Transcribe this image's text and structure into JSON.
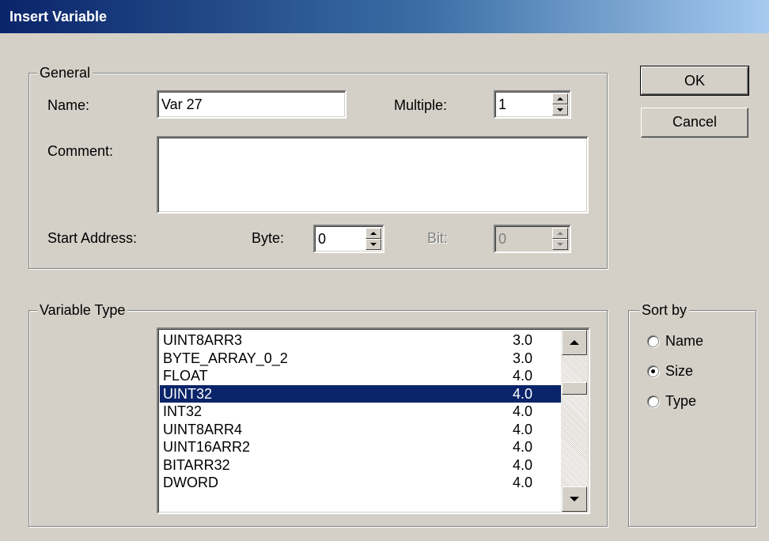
{
  "window": {
    "title": "Insert Variable"
  },
  "general": {
    "legend": "General",
    "name_label": "Name:",
    "name_value": "Var 27",
    "multiple_label": "Multiple:",
    "multiple_value": "1",
    "comment_label": "Comment:",
    "comment_value": "",
    "start_address_label": "Start Address:",
    "byte_label": "Byte:",
    "byte_value": "0",
    "bit_label": "Bit:",
    "bit_value": "0"
  },
  "buttons": {
    "ok": "OK",
    "cancel": "Cancel"
  },
  "variable_type": {
    "legend": "Variable Type",
    "items": [
      {
        "name": "UINT8ARR3",
        "size": "3.0"
      },
      {
        "name": "BYTE_ARRAY_0_2",
        "size": "3.0"
      },
      {
        "name": "FLOAT",
        "size": "4.0"
      },
      {
        "name": "UINT32",
        "size": "4.0",
        "selected": true
      },
      {
        "name": "INT32",
        "size": "4.0"
      },
      {
        "name": "UINT8ARR4",
        "size": "4.0"
      },
      {
        "name": "UINT16ARR2",
        "size": "4.0"
      },
      {
        "name": "BITARR32",
        "size": "4.0"
      },
      {
        "name": "DWORD",
        "size": "4.0"
      }
    ]
  },
  "sort_by": {
    "legend": "Sort by",
    "options": [
      {
        "label": "Name",
        "checked": false
      },
      {
        "label": "Size",
        "checked": true
      },
      {
        "label": "Type",
        "checked": false
      }
    ]
  }
}
